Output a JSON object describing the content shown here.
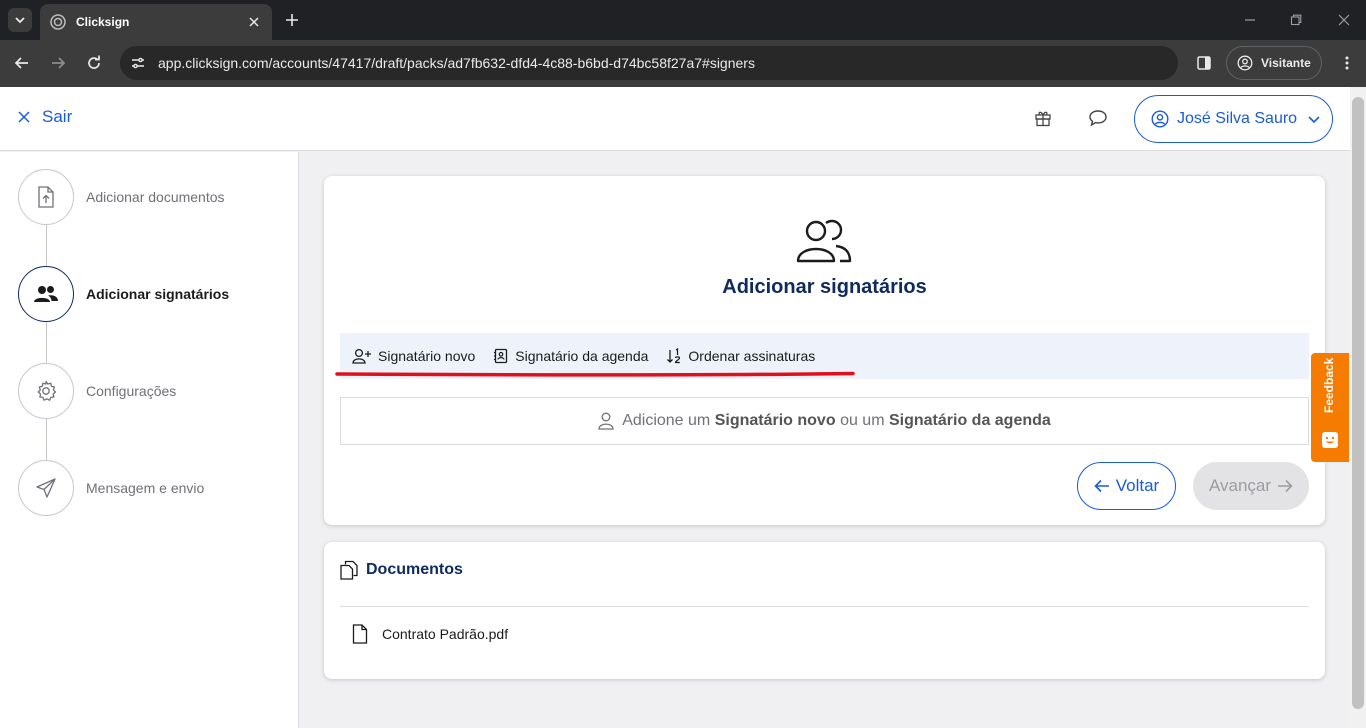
{
  "browser": {
    "tab_title": "Clicksign",
    "url": "app.clicksign.com/accounts/47417/draft/packs/ad7fb632-dfd4-4c88-b6bd-d74bc58f27a7#signers",
    "profile_label": "Visitante"
  },
  "header": {
    "exit_label": "Sair",
    "user_name": "José Silva Sauro"
  },
  "steps": [
    {
      "label": "Adicionar documentos",
      "icon": "file-upload-icon",
      "active": false
    },
    {
      "label": "Adicionar signatários",
      "icon": "users-icon",
      "active": true
    },
    {
      "label": "Configurações",
      "icon": "gear-icon",
      "active": false
    },
    {
      "label": "Mensagem e envio",
      "icon": "send-icon",
      "active": false
    }
  ],
  "main": {
    "title": "Adicionar signatários",
    "actions": {
      "new_signer": "Signatário novo",
      "contact_signer": "Signatário da agenda",
      "order_signatures": "Ordenar assinaturas"
    },
    "empty_state": {
      "prefix": "Adicione um",
      "new_signer": "Signatário novo",
      "middle": "ou um",
      "contact_signer": "Signatário da agenda"
    },
    "back_label": "Voltar",
    "next_label": "Avançar"
  },
  "documents": {
    "title": "Documentos",
    "items": [
      "Contrato Padrão.pdf"
    ]
  },
  "feedback": {
    "label": "Feedback"
  },
  "colors": {
    "accent": "#1a5bd6",
    "navy": "#0e2a5e",
    "feedback": "#f57c00",
    "annotation": "#e0101a"
  }
}
